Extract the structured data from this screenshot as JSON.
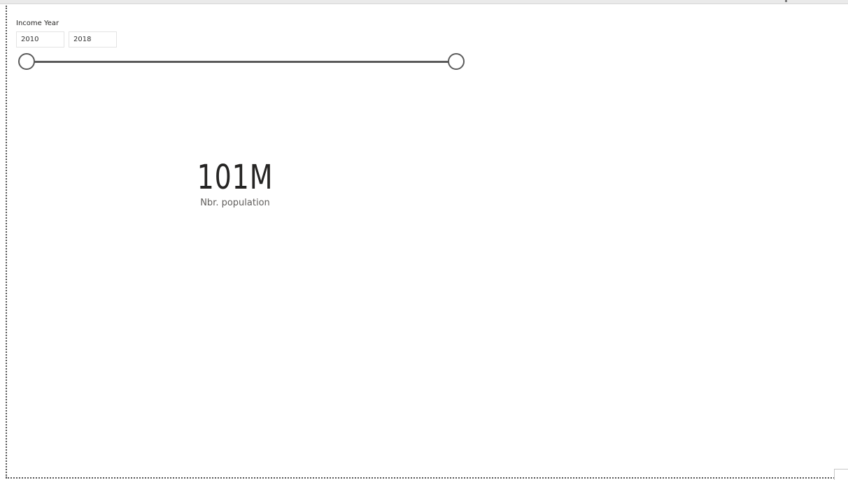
{
  "slicer": {
    "title": "Income Year",
    "range_start": "2010",
    "range_end": "2018",
    "slider_start_fraction": 0,
    "slider_end_fraction": 1
  },
  "card": {
    "value": "101M",
    "label": "Nbr. population"
  },
  "colors": {
    "track": "#5a5a5a",
    "value_text": "#252423",
    "label_text": "#605e5c"
  },
  "icons": {
    "slider_handle": "circle-handle-icon"
  }
}
